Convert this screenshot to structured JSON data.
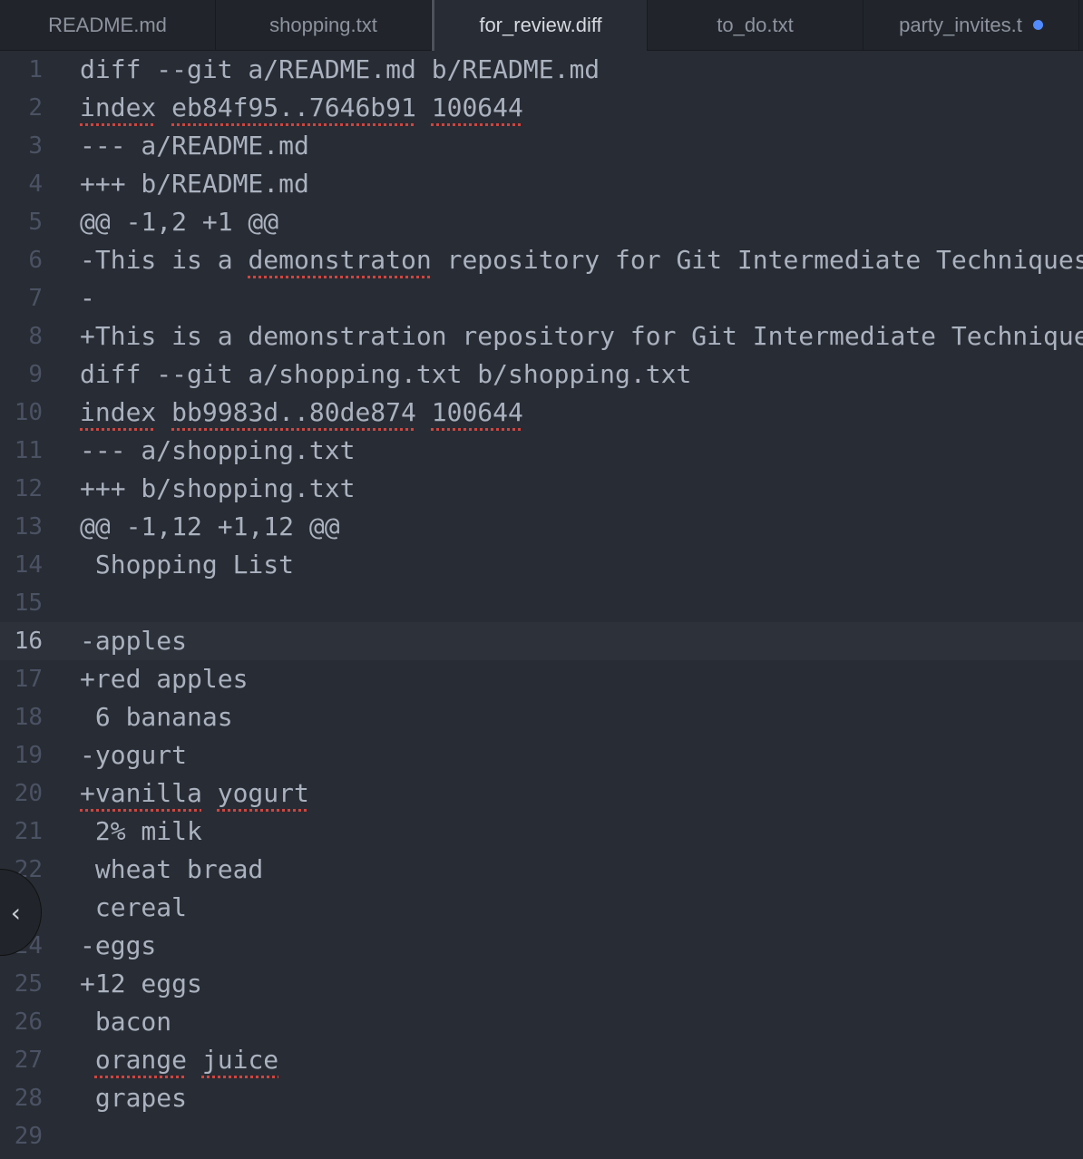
{
  "tabs": [
    {
      "label": "README.md",
      "active": false
    },
    {
      "label": "shopping.txt",
      "active": false
    },
    {
      "label": "for_review.diff",
      "active": true
    },
    {
      "label": "to_do.txt",
      "active": false
    },
    {
      "label": "party_invites.t",
      "active": false,
      "modified": true
    }
  ],
  "current_line": 16,
  "lines": [
    [
      {
        "t": "diff --git a/README.md b/README.md"
      }
    ],
    [
      {
        "t": "index",
        "e": 1
      },
      {
        "t": " "
      },
      {
        "t": "eb84f95..7646b91",
        "e": 1
      },
      {
        "t": " "
      },
      {
        "t": "100644",
        "e": 1
      }
    ],
    [
      {
        "t": "--- a/README.md"
      }
    ],
    [
      {
        "t": "+++ b/README.md"
      }
    ],
    [
      {
        "t": "@@ -1,2 +1 @@"
      }
    ],
    [
      {
        "t": "-This is a "
      },
      {
        "t": "demonstraton",
        "e": 1
      },
      {
        "t": " repository for Git Intermediate Techniques"
      }
    ],
    [
      {
        "t": "-"
      }
    ],
    [
      {
        "t": "+This is a demonstration repository for Git Intermediate Techniques"
      }
    ],
    [
      {
        "t": "diff --git a/shopping.txt b/shopping.txt"
      }
    ],
    [
      {
        "t": "index",
        "e": 1
      },
      {
        "t": " "
      },
      {
        "t": "bb9983d..80de874",
        "e": 1
      },
      {
        "t": " "
      },
      {
        "t": "100644",
        "e": 1
      }
    ],
    [
      {
        "t": "--- a/shopping.txt"
      }
    ],
    [
      {
        "t": "+++ b/shopping.txt"
      }
    ],
    [
      {
        "t": "@@ -1,12 +1,12 @@"
      }
    ],
    [
      {
        "t": " Shopping List"
      }
    ],
    [
      {
        "t": ""
      }
    ],
    [
      {
        "t": "-apples"
      }
    ],
    [
      {
        "t": "+red apples"
      }
    ],
    [
      {
        "t": " 6 bananas"
      }
    ],
    [
      {
        "t": "-yogurt"
      }
    ],
    [
      {
        "t": "+vanilla",
        "e": 1
      },
      {
        "t": " "
      },
      {
        "t": "yogurt",
        "e": 1
      }
    ],
    [
      {
        "t": " 2% milk"
      }
    ],
    [
      {
        "t": " wheat bread"
      }
    ],
    [
      {
        "t": " cereal"
      }
    ],
    [
      {
        "t": "-eggs"
      }
    ],
    [
      {
        "t": "+12 eggs"
      }
    ],
    [
      {
        "t": " bacon"
      }
    ],
    [
      {
        "t": " "
      },
      {
        "t": "orange",
        "e": 1
      },
      {
        "t": " "
      },
      {
        "t": "juice",
        "e": 1
      }
    ],
    [
      {
        "t": " grapes"
      }
    ],
    [
      {
        "t": ""
      }
    ]
  ]
}
